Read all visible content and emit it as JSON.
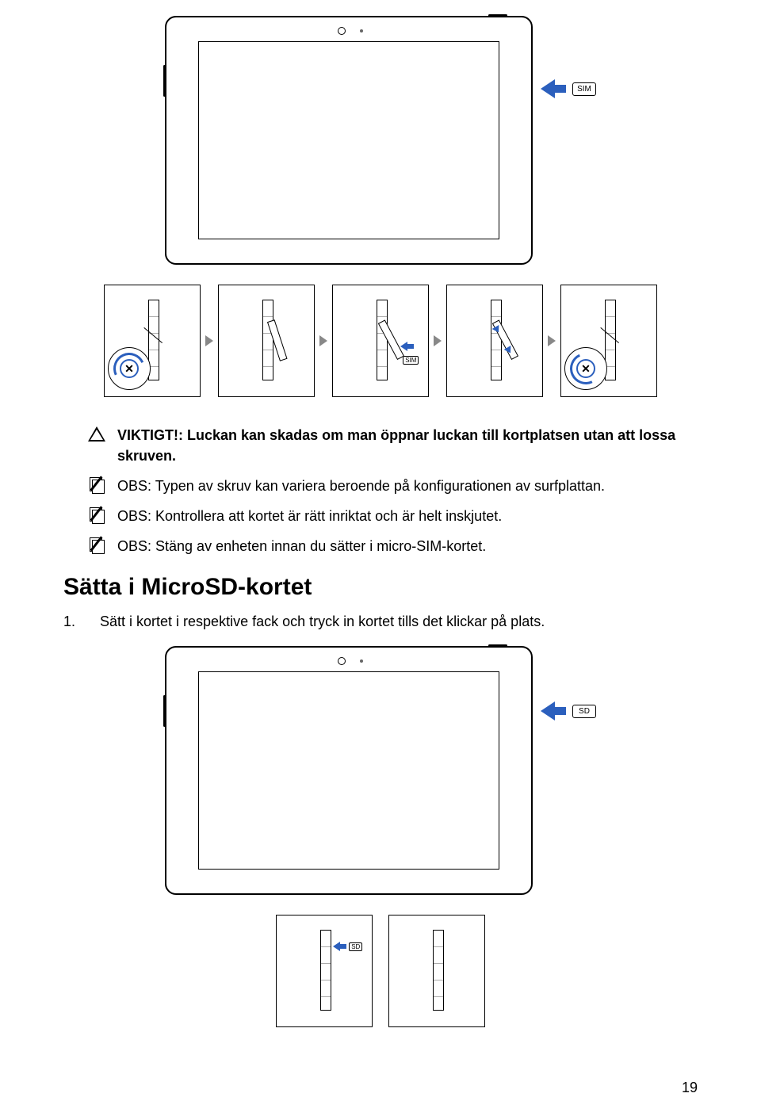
{
  "figure1": {
    "card_label": "SIM"
  },
  "steps_sim": {
    "insert_label": "SIM"
  },
  "warnings": {
    "viktigt": {
      "prefix": "VIKTIGT!: ",
      "text": "Luckan kan skadas om man öppnar luckan till kortplatsen utan att lossa skruven."
    },
    "obs1": {
      "prefix": "OBS: ",
      "text": "Typen av skruv kan variera beroende på konfigurationen av surfplattan."
    },
    "obs2": {
      "prefix": "OBS: ",
      "text": "Kontrollera att kortet är rätt inriktat och är helt inskjutet."
    },
    "obs3": {
      "prefix": "OBS: ",
      "text": "Stäng av enheten innan du sätter i micro-SIM-kortet."
    }
  },
  "section_heading": "Sätta i MicroSD-kortet",
  "step1": {
    "num": "1.",
    "text": "Sätt i kortet i respektive fack och tryck in kortet tills det klickar på plats."
  },
  "figure2": {
    "card_label": "SD"
  },
  "steps_sd": {
    "insert_label": "SD"
  },
  "page_number": "19"
}
